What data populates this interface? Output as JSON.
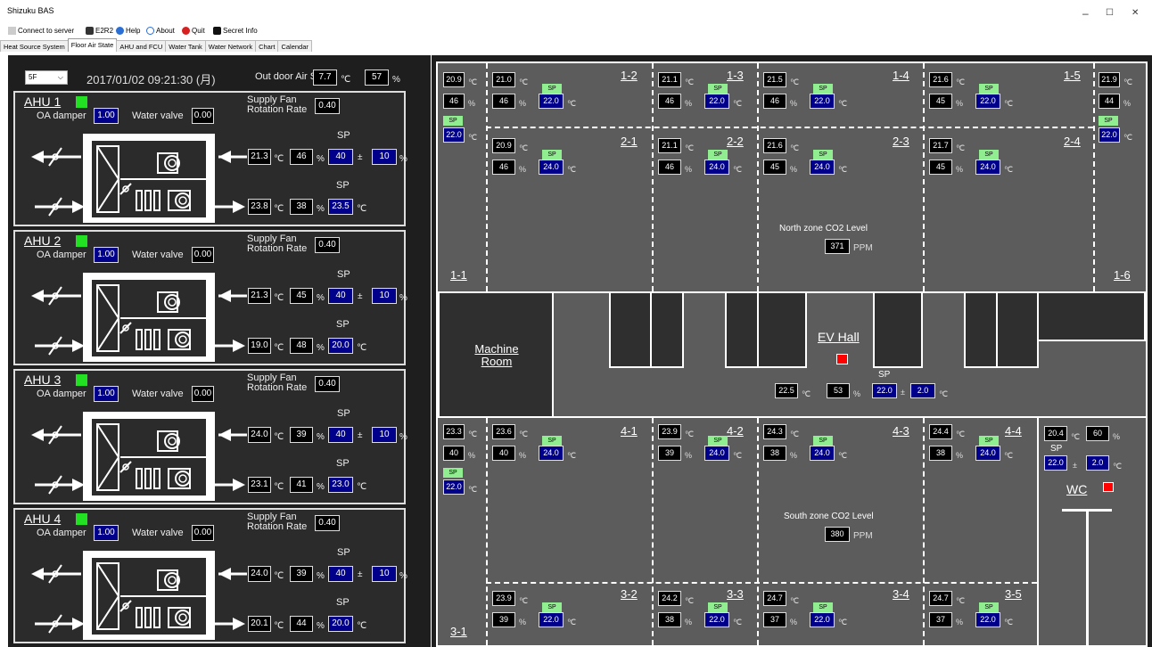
{
  "window": {
    "title": "Shizuku BAS",
    "min": "–",
    "max": "☐",
    "close": "✕"
  },
  "toolbar": [
    {
      "label": "Connect to server"
    },
    {
      "label": "E2R2"
    },
    {
      "label": "Help"
    },
    {
      "label": "About"
    },
    {
      "label": "Quit"
    },
    {
      "label": "Secret Info"
    }
  ],
  "tabs": [
    "Heat Source System",
    "Floor Air State",
    "AHU and FCU",
    "Water Tank",
    "Water Network",
    "Chart",
    "Calendar"
  ],
  "floor": "5F",
  "datetime": "2017/01/02 09:21:30 (月)",
  "outdoor": {
    "label": "Out door Air State",
    "temp": "7.7",
    "hum": "57",
    "cu": "℃",
    "pu": "%"
  },
  "ahu_labels": {
    "oa": "OA damper",
    "wv": "Water valve",
    "sf1": "Supply Fan",
    "sf2": "Rotation Rate",
    "sp": "SP",
    "pm": "±"
  },
  "ahus": [
    {
      "name": "AHU 1",
      "oa": "1.00",
      "wv": "0.00",
      "sf": "0.40",
      "t1": "21.3",
      "h1": "46",
      "sph": "40",
      "band": "10",
      "t2": "23.8",
      "h2": "38",
      "spt": "23.5"
    },
    {
      "name": "AHU 2",
      "oa": "1.00",
      "wv": "0.00",
      "sf": "0.40",
      "t1": "21.3",
      "h1": "45",
      "sph": "40",
      "band": "10",
      "t2": "19.0",
      "h2": "48",
      "spt": "20.0"
    },
    {
      "name": "AHU 3",
      "oa": "1.00",
      "wv": "0.00",
      "sf": "0.40",
      "t1": "24.0",
      "h1": "39",
      "sph": "40",
      "band": "10",
      "t2": "23.1",
      "h2": "41",
      "spt": "23.0"
    },
    {
      "name": "AHU 4",
      "oa": "1.00",
      "wv": "0.00",
      "sf": "0.40",
      "t1": "24.0",
      "h1": "39",
      "sph": "40",
      "band": "10",
      "t2": "20.1",
      "h2": "44",
      "spt": "20.0"
    }
  ],
  "zones": {
    "z1_1": {
      "name": "1-1",
      "t": "20.9",
      "h": "46",
      "sp": "22.0"
    },
    "z1_2": {
      "name": "1-2",
      "t": "21.0",
      "h": "46",
      "sp": "22.0"
    },
    "z1_3": {
      "name": "1-3",
      "t": "21.1",
      "h": "46",
      "sp": "22.0"
    },
    "z1_4": {
      "name": "1-4",
      "t": "21.5",
      "h": "46",
      "sp": "22.0"
    },
    "z1_5": {
      "name": "1-5",
      "t": "21.6",
      "h": "45",
      "sp": "22.0"
    },
    "z1_6": {
      "name": "1-6",
      "t": "21.9",
      "h": "44",
      "sp": "22.0"
    },
    "z2_1": {
      "name": "2-1",
      "t": "20.9",
      "h": "46",
      "sp": "24.0"
    },
    "z2_2": {
      "name": "2-2",
      "t": "21.1",
      "h": "46",
      "sp": "24.0"
    },
    "z2_3": {
      "name": "2-3",
      "t": "21.6",
      "h": "45",
      "sp": "24.0"
    },
    "z2_4": {
      "name": "2-4",
      "t": "21.7",
      "h": "45",
      "sp": "24.0"
    },
    "z3_1": {
      "name": "3-1",
      "t": "23.3",
      "h": "40",
      "sp": "22.0"
    },
    "z4_1": {
      "name": "4-1",
      "t": "23.6",
      "h": "40",
      "sp": "24.0"
    },
    "z4_2": {
      "name": "4-2",
      "t": "23.9",
      "h": "39",
      "sp": "24.0"
    },
    "z4_3": {
      "name": "4-3",
      "t": "24.3",
      "h": "38",
      "sp": "24.0"
    },
    "z4_4": {
      "name": "4-4",
      "t": "24.4",
      "h": "38",
      "sp": "24.0"
    },
    "z3_2": {
      "name": "3-2",
      "t": "23.9",
      "h": "39",
      "sp": "22.0"
    },
    "z3_3": {
      "name": "3-3",
      "t": "24.2",
      "h": "38",
      "sp": "22.0"
    },
    "z3_4": {
      "name": "3-4",
      "t": "24.7",
      "h": "37",
      "sp": "22.0"
    },
    "z3_5": {
      "name": "3-5",
      "t": "24.7",
      "h": "37",
      "sp": "22.0"
    }
  },
  "sp_label": "SP",
  "cu": "℃",
  "pu": "%",
  "north_co2": {
    "label": "North zone CO2 Level",
    "value": "371",
    "unit": "PPM"
  },
  "south_co2": {
    "label": "South zone CO2 Level",
    "value": "380",
    "unit": "PPM"
  },
  "machine_room": [
    "Machine",
    "Room"
  ],
  "ev_hall": {
    "label": "EV Hall",
    "t": "22.5",
    "h": "53",
    "sp": "22.0",
    "band": "2.0",
    "pm": "±",
    "sp_label": "SP"
  },
  "wc": {
    "label": "WC",
    "t": "20.4",
    "h": "60",
    "sp": "22.0",
    "band": "2.0",
    "pm": "±",
    "sp_label": "SP"
  },
  "colors": {
    "on": "#22e022",
    "alarm": "#ff0000",
    "sp_green": "#90ee90",
    "sp_blue": "#00008b"
  }
}
